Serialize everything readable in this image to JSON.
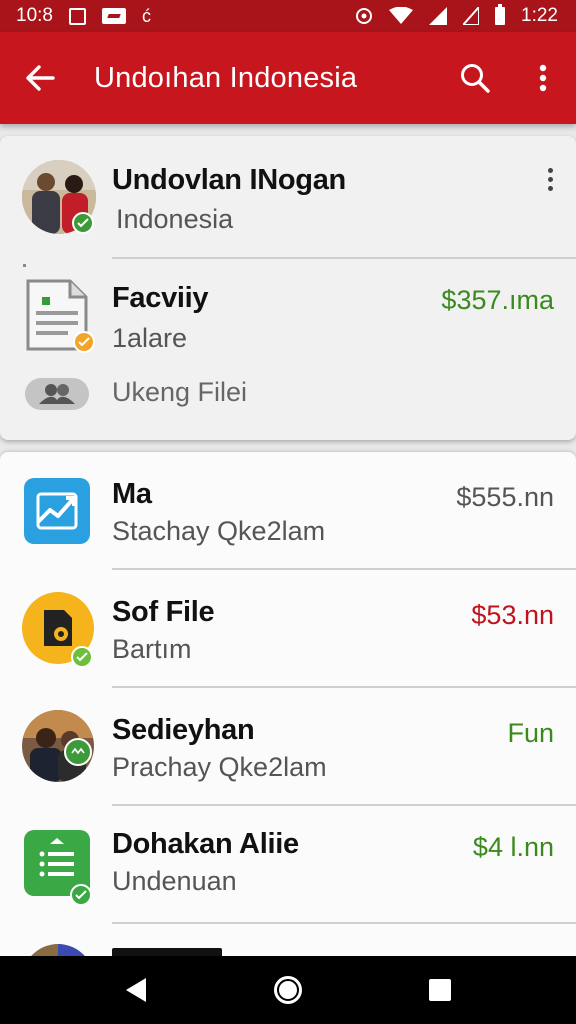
{
  "status_bar": {
    "left_text": "10:8",
    "clock": "1:22",
    "glyph": "ć"
  },
  "app_bar": {
    "title": "Undoıhan Indonesia"
  },
  "header_card": {
    "profile": {
      "name": "Undovlan INogan",
      "subtitle": "Indonesia"
    },
    "file": {
      "title": "Facviiy",
      "subtitle": "1alare",
      "amount": "$357.ıma"
    },
    "chip": {
      "label": "Ukeng Filei"
    }
  },
  "list": [
    {
      "title": "Ma",
      "subtitle": "Stachay Qke2lam",
      "amount": "$555.nn",
      "amount_color": "#555555",
      "icon": "trend-chart-icon"
    },
    {
      "title": "Sof File",
      "subtitle": "Bartım",
      "amount": "$53.nn",
      "amount_color": "#c0141c",
      "icon": "gear-file-icon"
    },
    {
      "title": "Sedieyhan",
      "subtitle": "Prachay Qke2lam",
      "amount": "Fun",
      "amount_color": "#3a8a1e",
      "icon": "avatar"
    },
    {
      "title": "Dohakan Aliie",
      "subtitle": "Undenuan",
      "amount": "$4 l.nn",
      "amount_color": "#3a8a1e",
      "icon": "list-doc-icon"
    }
  ],
  "colors": {
    "primary": "#c8161f",
    "status_bar": "#a8141a",
    "positive": "#3a8a1e",
    "negative": "#c0141c"
  }
}
